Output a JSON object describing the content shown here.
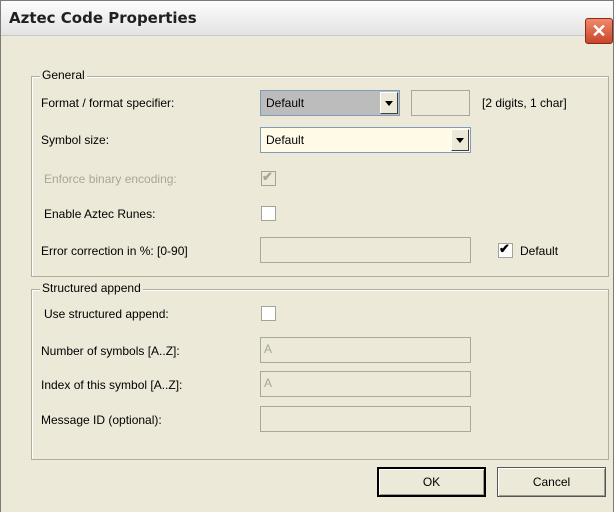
{
  "dialog": {
    "title": "Aztec Code Properties",
    "close_glyph": "✕"
  },
  "general": {
    "group_label": "General",
    "format_label": "Format / format specifier:",
    "format_value": "Default",
    "format_hint": "[2 digits, 1 char]",
    "symbol_size_label": "Symbol size:",
    "symbol_size_value": "Default",
    "enforce_binary_label": "Enforce binary encoding:",
    "enforce_binary_checked": true,
    "enable_runes_label": "Enable Aztec Runes:",
    "enable_runes_checked": false,
    "error_correction_label": "Error correction in %: [0-90]",
    "error_correction_value": "",
    "default_label": "Default",
    "default_checked": true
  },
  "structured": {
    "group_label": "Structured append",
    "use_label": "Use structured append:",
    "use_checked": false,
    "num_symbols_label": "Number of symbols [A..Z]:",
    "num_symbols_value": "A",
    "index_label": "Index of this symbol [A..Z]:",
    "index_value": "A",
    "message_id_label": "Message ID (optional):",
    "message_id_value": ""
  },
  "buttons": {
    "ok": "OK",
    "cancel": "Cancel"
  },
  "check_glyph": "✔"
}
